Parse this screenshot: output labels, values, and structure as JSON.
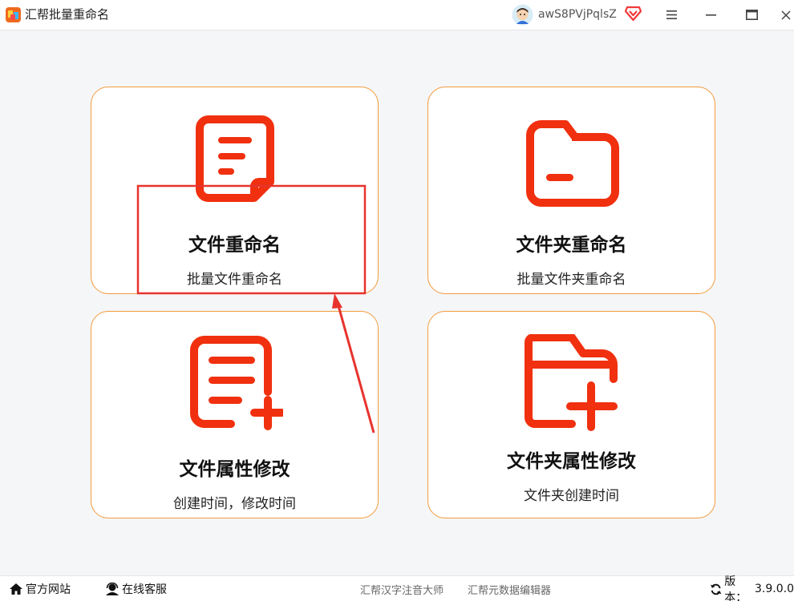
{
  "app": {
    "title": "汇帮批量重命名"
  },
  "user": {
    "name": "awS8PVjPqlsZ"
  },
  "icons": {
    "app_logo": "app-logo-icon",
    "avatar": "avatar-icon",
    "vip": "vip-diamond-icon",
    "menu": "menu-icon",
    "minimize": "minimize-icon",
    "maximize": "maximize-icon",
    "close": "close-icon",
    "home": "home-icon",
    "service": "headset-icon",
    "refresh": "refresh-icon"
  },
  "colors": {
    "accent": "#f0300f",
    "card_border": "#f29b3c",
    "annotation": "#e8332d"
  },
  "cards": [
    {
      "title": "文件重命名",
      "subtitle": "批量文件重命名",
      "icon": "document-icon"
    },
    {
      "title": "文件夹重命名",
      "subtitle": "批量文件夹重命名",
      "icon": "folder-minus-icon"
    },
    {
      "title": "文件属性修改",
      "subtitle": "创建时间，修改时间",
      "icon": "document-plus-icon"
    },
    {
      "title": "文件夹属性修改",
      "subtitle": "文件夹创建时间",
      "icon": "folder-plus-icon"
    }
  ],
  "footer": {
    "site": "官方网站",
    "service": "在线客服",
    "app1": "汇帮汉字注音大师",
    "app2": "汇帮元数据编辑器",
    "version_label": "版本：",
    "version": "3.9.0.0"
  }
}
